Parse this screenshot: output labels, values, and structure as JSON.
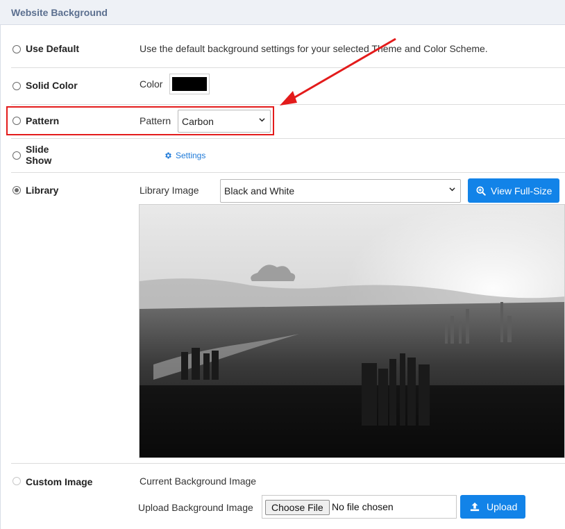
{
  "panel": {
    "title": "Website Background"
  },
  "options": {
    "use_default": {
      "label": "Use Default",
      "description": "Use the default background settings for your selected Theme and Color Scheme."
    },
    "solid_color": {
      "label": "Solid Color",
      "field_label": "Color",
      "color_value": "#000000"
    },
    "pattern": {
      "label": "Pattern",
      "field_label": "Pattern",
      "selected": "Carbon"
    },
    "slide_show": {
      "label_line1": "Slide",
      "label_line2": "Show",
      "settings_link": "Settings"
    },
    "library": {
      "label": "Library",
      "field_label": "Library Image",
      "selected": "Black and White",
      "view_button": "View Full-Size",
      "selected_state": "checked"
    },
    "custom_image": {
      "label": "Custom Image",
      "current_label": "Current Background Image",
      "upload_label": "Upload Background Image",
      "choose_file": "Choose File",
      "file_status": "No file chosen",
      "upload_button": "Upload"
    }
  },
  "colors": {
    "accent": "#1283e8",
    "highlight": "#e31b1b",
    "header_bg": "#eef1f6",
    "header_text": "#5b6f8f"
  },
  "icons": {
    "settings": "gear-icon",
    "zoom": "zoom-in-icon",
    "upload": "upload-icon",
    "dropdown": "chevron-down-icon"
  }
}
